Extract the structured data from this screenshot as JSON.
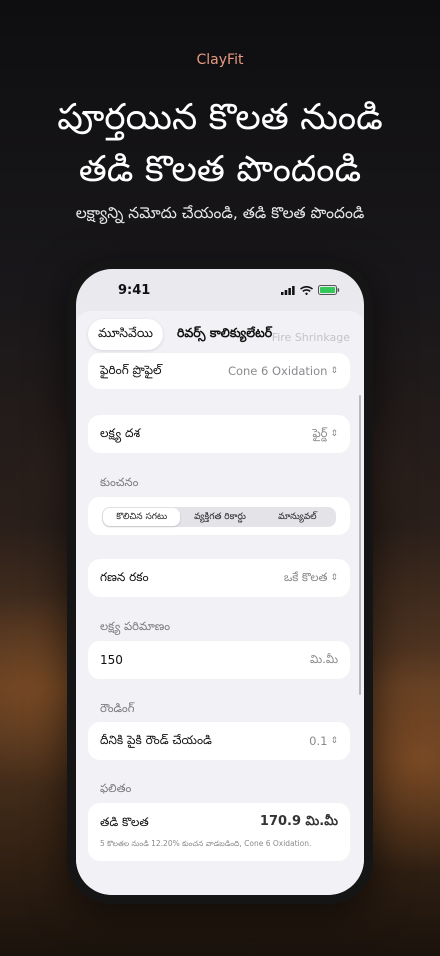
{
  "brand": "ClayFit",
  "headline_line1": "పూర్తయిన కొలత నుండి",
  "headline_line2": "తడి కొలత పొందండి",
  "subheadline": "లక్ష్యాన్ని నమోదు చేయండి, తడి కొలత పొందండి",
  "status": {
    "time": "9:41"
  },
  "tabs": {
    "close": "మూసివేయి",
    "title": "రివర్స్ కాలిక్యులేటర్",
    "ghost": "Fire Shrinkage"
  },
  "firing_profile": {
    "label": "ఫైరింగ్ ప్రొఫైల్",
    "value": "Cone 6 Oxidation"
  },
  "target_stage": {
    "label": "లక్ష్య దశ",
    "value": "ఫైర్డ్"
  },
  "shrinkage": {
    "header": "కుంచనం",
    "options": [
      "కొలిచిన సగటు",
      "వ్యక్తిగత రికార్డు",
      "మాన్యువల్"
    ],
    "selected": "కొలిచిన సగటు"
  },
  "calc_type": {
    "label": "గణన రకం",
    "value": "ఒకే కొలత"
  },
  "target_size": {
    "header": "లక్ష్య పరిమాణం",
    "value": "150",
    "unit": "మి.మీ"
  },
  "rounding": {
    "header": "రౌండింగ్",
    "label": "దీనికి పైకి రౌండ్ చేయండి",
    "value": "0.1"
  },
  "result": {
    "header": "ఫలితం",
    "label": "తడి కొలత",
    "value": "170.9 మి.మీ",
    "note": "5 కొలతల నుండి 12.20% కుంచన వాడబడింది, Cone 6 Oxidation."
  }
}
